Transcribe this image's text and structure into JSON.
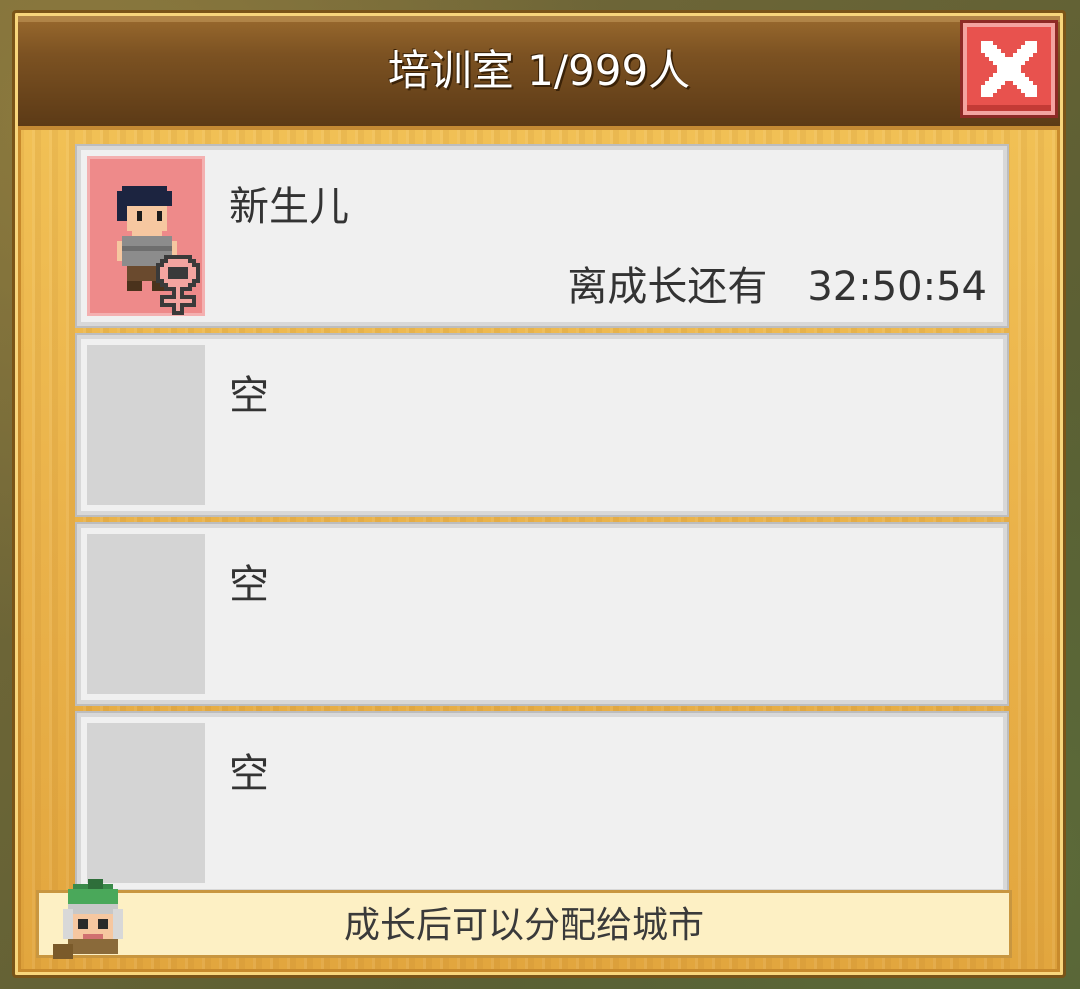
{
  "window": {
    "title": "培训室 1/999人"
  },
  "slots": [
    {
      "name": "新生儿",
      "timer_label": "离成长还有",
      "timer_value": "32:50:54",
      "occupied": true,
      "avatar_icon": "child-character-icon",
      "gender_icon": "female-icon"
    },
    {
      "name": "空",
      "occupied": false
    },
    {
      "name": "空",
      "occupied": false
    },
    {
      "name": "空",
      "occupied": false
    }
  ],
  "footer": {
    "text": "成长后可以分配给城市",
    "avatar_icon": "advisor-character-icon"
  },
  "colors": {
    "frame": "#eab24a",
    "title_bar": "#7c5222",
    "close_button": "#e8524e",
    "occupied_slot": "#ee8a8a",
    "empty_slot": "#d4d4d4"
  }
}
